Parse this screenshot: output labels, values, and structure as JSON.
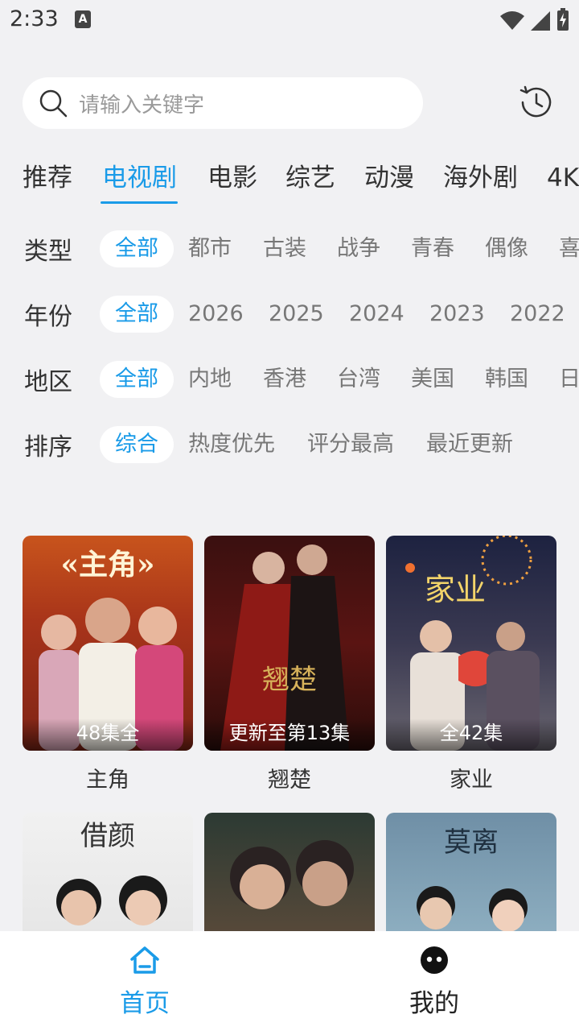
{
  "status_bar": {
    "time": "2:33",
    "a_icon": "A"
  },
  "search": {
    "placeholder": "请输入关键字"
  },
  "tabs": [
    {
      "label": "推荐",
      "active": false
    },
    {
      "label": "电视剧",
      "active": true
    },
    {
      "label": "电影",
      "active": false
    },
    {
      "label": "综艺",
      "active": false
    },
    {
      "label": "动漫",
      "active": false
    },
    {
      "label": "海外剧",
      "active": false
    },
    {
      "label": "4K",
      "active": false
    }
  ],
  "filters": {
    "type": {
      "label": "类型",
      "options": [
        "全部",
        "都市",
        "古装",
        "战争",
        "青春",
        "偶像",
        "喜"
      ],
      "selected": "全部"
    },
    "year": {
      "label": "年份",
      "options": [
        "全部",
        "2026",
        "2025",
        "2024",
        "2023",
        "2022"
      ],
      "selected": "全部"
    },
    "region": {
      "label": "地区",
      "options": [
        "全部",
        "内地",
        "香港",
        "台湾",
        "美国",
        "韩国",
        "日"
      ],
      "selected": "全部"
    },
    "sort": {
      "label": "排序",
      "options": [
        "综合",
        "热度优先",
        "评分最高",
        "最近更新"
      ],
      "selected": "综合"
    }
  },
  "cards": [
    {
      "title": "主角",
      "caption": "48集全",
      "poster_text": "«主角»"
    },
    {
      "title": "翘楚",
      "caption": "更新至第13集",
      "poster_text": "翘楚"
    },
    {
      "title": "家业",
      "caption": "全42集",
      "poster_text": "家业"
    },
    {
      "title": "",
      "caption": "",
      "poster_text": "借颜"
    },
    {
      "title": "",
      "caption": "",
      "poster_text": ""
    },
    {
      "title": "",
      "caption": "",
      "poster_text": "莫离"
    }
  ],
  "bottom_nav": [
    {
      "label": "首页",
      "icon": "home-icon",
      "active": true
    },
    {
      "label": "我的",
      "icon": "profile-icon",
      "active": false
    }
  ],
  "colors": {
    "accent": "#1a9be8",
    "background": "#f1f1f3"
  }
}
